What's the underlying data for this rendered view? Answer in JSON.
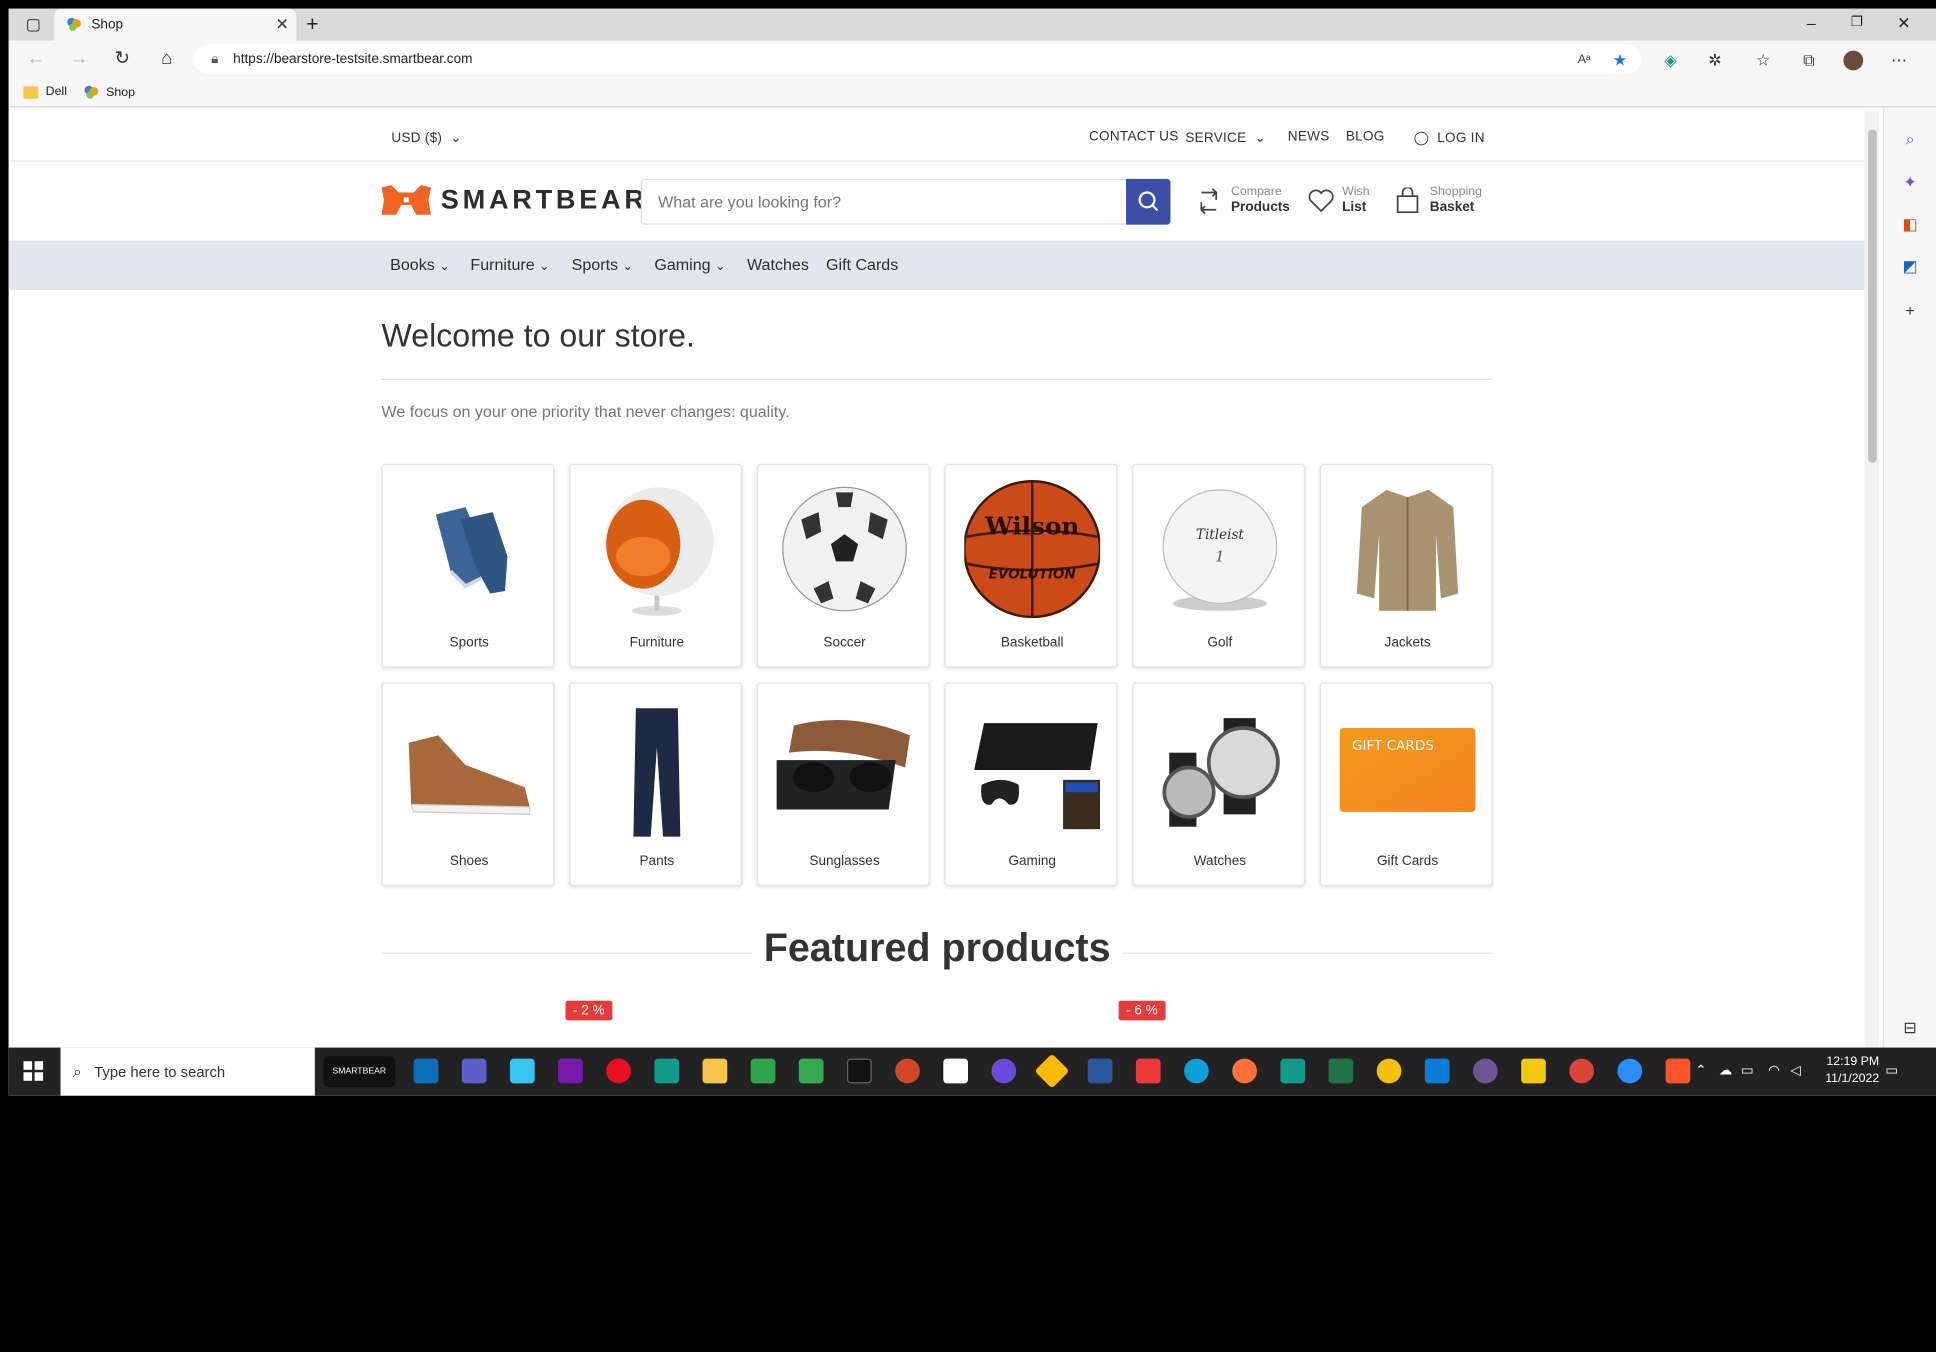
{
  "browser": {
    "tab_title": "Shop",
    "url": "https://bearstore-testsite.smartbear.com",
    "bookmarks": [
      "Dell",
      "Shop"
    ]
  },
  "store": {
    "currency": "USD ($)",
    "top_links": {
      "contact": "CONTACT US",
      "service": "SERVICE",
      "news": "NEWS",
      "blog": "BLOG",
      "login": "LOG IN"
    },
    "brand": "SMARTBEAR",
    "search_placeholder": "What are you looking for?",
    "header_links": [
      {
        "small": "Compare",
        "big": "Products"
      },
      {
        "small": "Wish",
        "big": "List"
      },
      {
        "small": "Shopping",
        "big": "Basket"
      }
    ],
    "menu": [
      "Books",
      "Furniture",
      "Sports",
      "Gaming",
      "Watches",
      "Gift Cards"
    ],
    "welcome": "Welcome to our store.",
    "tagline": "We focus on your one priority that never changes: quality.",
    "categories": [
      "Sports",
      "Furniture",
      "Soccer",
      "Basketball",
      "Golf",
      "Jackets",
      "Shoes",
      "Pants",
      "Sunglasses",
      "Gaming",
      "Watches",
      "Gift Cards"
    ],
    "gift_card_text": "GIFT CARDS",
    "featured_title": "Featured products",
    "badges": [
      "- 2 %",
      "- 6 %"
    ]
  },
  "taskbar": {
    "search_placeholder": "Type here to search",
    "pinned_label": "SMARTBEAR",
    "time": "12:19 PM",
    "date": "11/1/2022"
  }
}
